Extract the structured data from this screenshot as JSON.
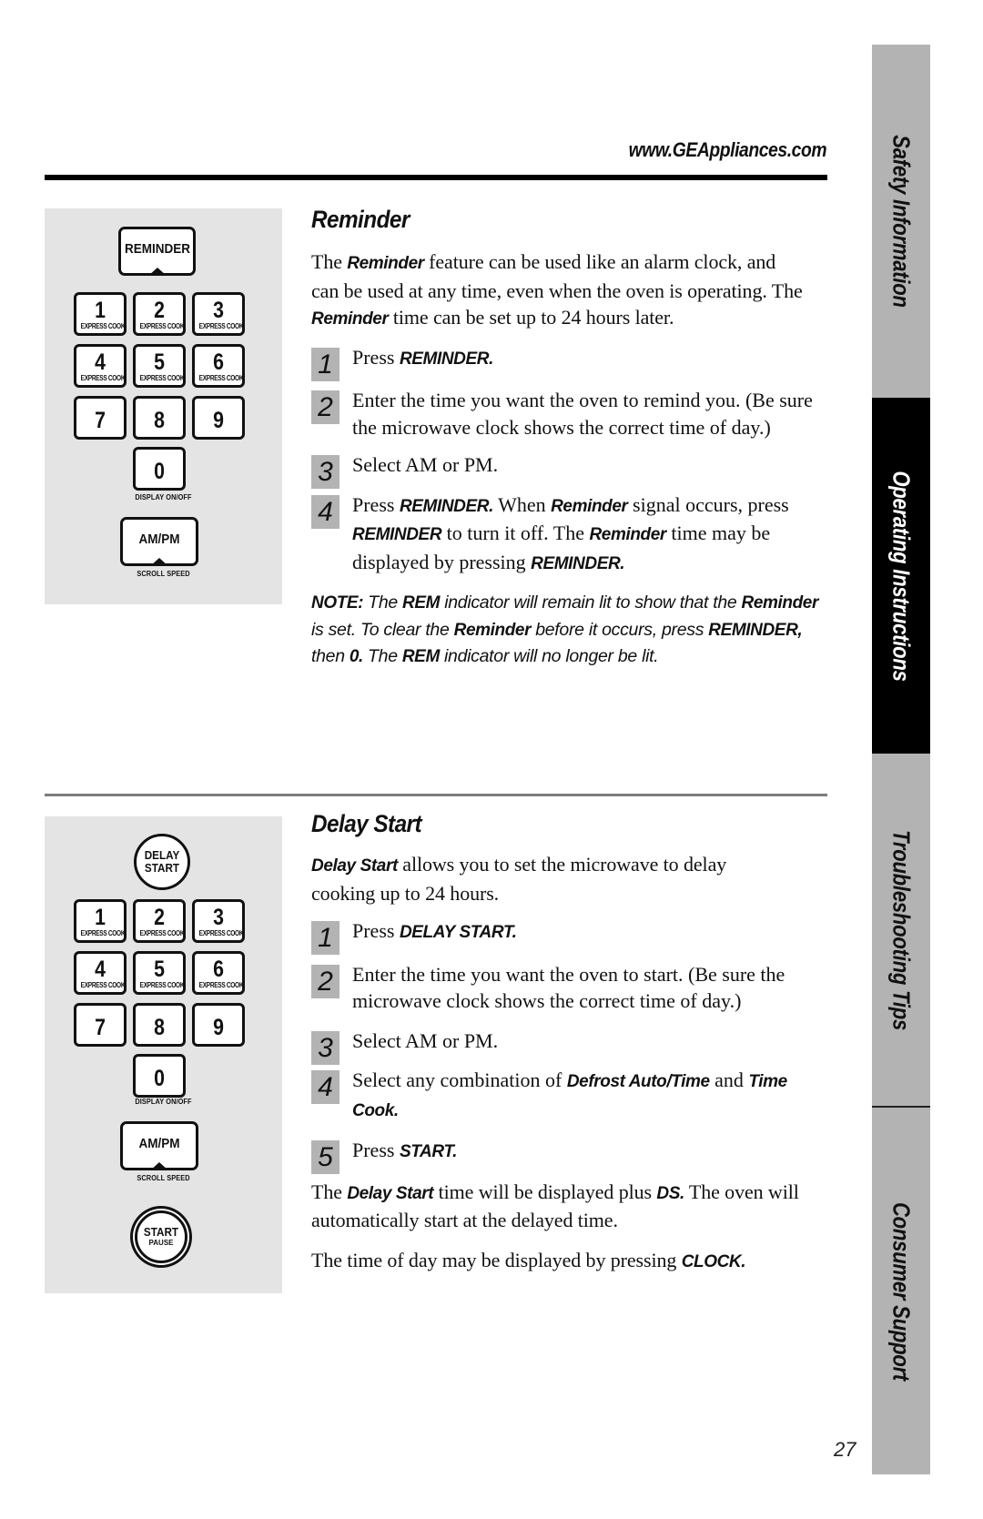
{
  "header": {
    "url": "www.GEAppliances.com"
  },
  "reminder": {
    "title": "Reminder",
    "intro": [
      {
        "t": "The "
      },
      {
        "b": "Reminder"
      },
      {
        "t": "  feature can be used like an alarm clock, and can be used at any time, even when the oven is operating. The "
      },
      {
        "b": "Reminder"
      },
      {
        "t": "  time can be set up to 24 hours later."
      }
    ],
    "steps": [
      {
        "num": "1",
        "parts": [
          {
            "t": "Press "
          },
          {
            "b": "REMINDER."
          }
        ]
      },
      {
        "num": "2",
        "parts": [
          {
            "t": "Enter the time you want the oven to remind you. (Be sure the microwave clock shows the correct time of day.)"
          }
        ]
      },
      {
        "num": "3",
        "parts": [
          {
            "t": "Select AM or PM."
          }
        ]
      },
      {
        "num": "4",
        "parts": [
          {
            "t": "Press "
          },
          {
            "b": "REMINDER."
          },
          {
            "t": " When "
          },
          {
            "b": "Reminder"
          },
          {
            "t": "  signal occurs, press "
          },
          {
            "b": "REMINDER"
          },
          {
            "t": "  to turn it off. The "
          },
          {
            "b": "Reminder"
          },
          {
            "t": " time may be displayed by pressing "
          },
          {
            "b": "REMINDER."
          }
        ]
      }
    ],
    "note": [
      {
        "b": "NOTE:"
      },
      {
        "t": " The "
      },
      {
        "b": "REM"
      },
      {
        "t": " indicator will remain lit to show that the "
      },
      {
        "b": "Reminder"
      },
      {
        "t": " is set. To clear the "
      },
      {
        "b": "Reminder"
      },
      {
        "t": " before it occurs, press "
      },
      {
        "b": "REMINDER,"
      },
      {
        "t": " then "
      },
      {
        "b": "0."
      },
      {
        "t": " The "
      },
      {
        "b": "REM"
      },
      {
        "t": " indicator will no longer be lit."
      }
    ],
    "keypad": {
      "top_key": "REMINDER",
      "digits": [
        {
          "num": "1",
          "sub": "EXPRESS COOK"
        },
        {
          "num": "2",
          "sub": "EXPRESS COOK"
        },
        {
          "num": "3",
          "sub": "EXPRESS COOK"
        },
        {
          "num": "4",
          "sub": "EXPRESS COOK"
        },
        {
          "num": "5",
          "sub": "EXPRESS COOK"
        },
        {
          "num": "6",
          "sub": "EXPRESS COOK"
        },
        {
          "num": "7",
          "sub": ""
        },
        {
          "num": "8",
          "sub": ""
        },
        {
          "num": "9",
          "sub": ""
        },
        {
          "num": "0",
          "sub": ""
        }
      ],
      "zero_caption": "DISPLAY ON/OFF",
      "ampm_key": "AM/PM",
      "ampm_caption": "SCROLL SPEED"
    }
  },
  "delay_start": {
    "title": "Delay Start",
    "intro": [
      {
        "b": "Delay Start"
      },
      {
        "t": " allows you to set the microwave to delay cooking up to 24 hours."
      }
    ],
    "steps": [
      {
        "num": "1",
        "parts": [
          {
            "t": "Press "
          },
          {
            "b": "DELAY START."
          }
        ]
      },
      {
        "num": "2",
        "parts": [
          {
            "t": "Enter the time you want the oven to start. (Be sure the microwave clock shows the correct time of day.)"
          }
        ]
      },
      {
        "num": "3",
        "parts": [
          {
            "t": "Select AM or PM."
          }
        ]
      },
      {
        "num": "4",
        "parts": [
          {
            "t": "Select any combination of "
          },
          {
            "b": "Defrost Auto/Time"
          },
          {
            "t": "  and "
          },
          {
            "b": "Time Cook."
          }
        ]
      },
      {
        "num": "5",
        "parts": [
          {
            "t": "Press "
          },
          {
            "b": "START."
          }
        ]
      }
    ],
    "outro1": [
      {
        "t": "The "
      },
      {
        "b": "Delay Start"
      },
      {
        "t": "  time will be displayed plus "
      },
      {
        "b": "DS."
      },
      {
        "t": " The oven will automatically start at the delayed time."
      }
    ],
    "outro2": [
      {
        "t": "The time of day may be displayed by pressing "
      },
      {
        "b": "CLOCK."
      }
    ],
    "keypad": {
      "top_key_line1": "DELAY",
      "top_key_line2": "START",
      "digits": [
        {
          "num": "1",
          "sub": "EXPRESS COOK"
        },
        {
          "num": "2",
          "sub": "EXPRESS COOK"
        },
        {
          "num": "3",
          "sub": "EXPRESS COOK"
        },
        {
          "num": "4",
          "sub": "EXPRESS COOK"
        },
        {
          "num": "5",
          "sub": "EXPRESS COOK"
        },
        {
          "num": "6",
          "sub": "EXPRESS COOK"
        },
        {
          "num": "7",
          "sub": ""
        },
        {
          "num": "8",
          "sub": ""
        },
        {
          "num": "9",
          "sub": ""
        },
        {
          "num": "0",
          "sub": ""
        }
      ],
      "zero_caption": "DISPLAY ON/OFF",
      "ampm_key": "AM/PM",
      "ampm_caption": "SCROLL SPEED",
      "start_key": "START",
      "start_sub": "PAUSE"
    }
  },
  "sidebar": {
    "tabs": [
      {
        "label": "Safety Information",
        "active": false
      },
      {
        "label": "Operating Instructions",
        "active": true
      },
      {
        "label": "Troubleshooting Tips",
        "active": false
      },
      {
        "label": "Consumer Support",
        "active": false
      }
    ]
  },
  "page_number": "27"
}
